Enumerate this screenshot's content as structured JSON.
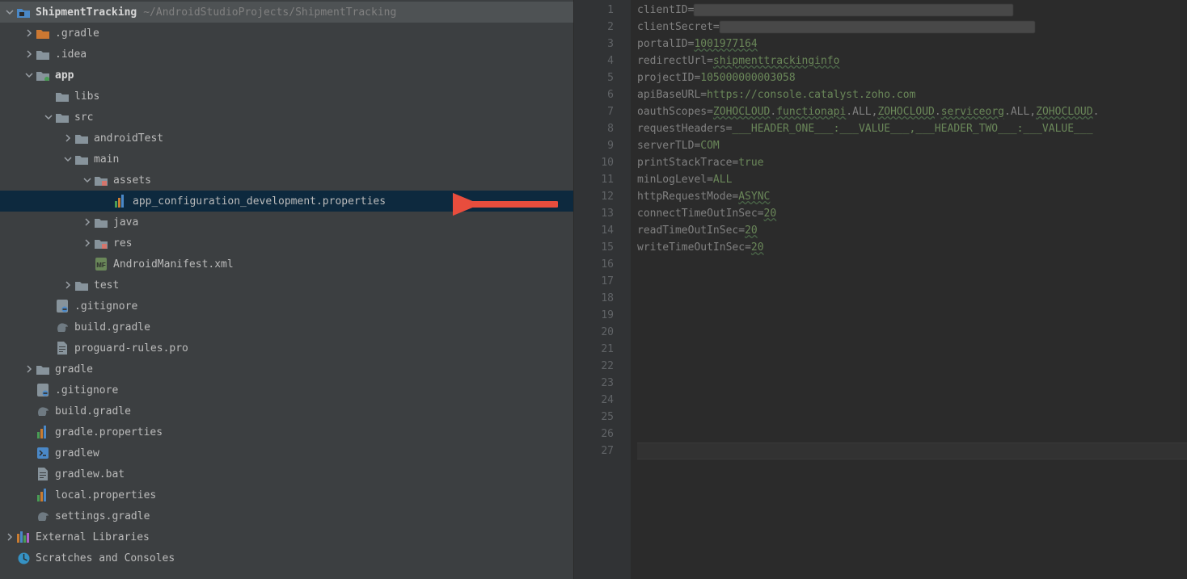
{
  "projectRoot": {
    "name": "ShipmentTracking",
    "path": "~/AndroidStudioProjects/ShipmentTracking"
  },
  "tree": [
    {
      "depth": 1,
      "arrow": "right",
      "icon": "folder-orange",
      "label": ".gradle"
    },
    {
      "depth": 1,
      "arrow": "right",
      "icon": "folder",
      "label": ".idea"
    },
    {
      "depth": 1,
      "arrow": "down",
      "icon": "module",
      "label": "app",
      "bold": true
    },
    {
      "depth": 2,
      "arrow": "none",
      "icon": "folder",
      "label": "libs"
    },
    {
      "depth": 2,
      "arrow": "down",
      "icon": "folder",
      "label": "src"
    },
    {
      "depth": 3,
      "arrow": "right",
      "icon": "folder",
      "label": "androidTest"
    },
    {
      "depth": 3,
      "arrow": "down",
      "icon": "folder",
      "label": "main"
    },
    {
      "depth": 4,
      "arrow": "down",
      "icon": "resource-folder",
      "label": "assets"
    },
    {
      "depth": 5,
      "arrow": "none",
      "icon": "properties",
      "label": "app_configuration_development.properties",
      "selected": true
    },
    {
      "depth": 4,
      "arrow": "right",
      "icon": "folder",
      "label": "java"
    },
    {
      "depth": 4,
      "arrow": "right",
      "icon": "resource-folder",
      "label": "res"
    },
    {
      "depth": 4,
      "arrow": "none",
      "icon": "manifest",
      "label": "AndroidManifest.xml"
    },
    {
      "depth": 3,
      "arrow": "right",
      "icon": "folder",
      "label": "test"
    },
    {
      "depth": 2,
      "arrow": "none",
      "icon": "gitignore",
      "label": ".gitignore"
    },
    {
      "depth": 2,
      "arrow": "none",
      "icon": "gradle-elephant",
      "label": "build.gradle"
    },
    {
      "depth": 2,
      "arrow": "none",
      "icon": "text-file",
      "label": "proguard-rules.pro"
    },
    {
      "depth": 1,
      "arrow": "right",
      "icon": "folder",
      "label": "gradle"
    },
    {
      "depth": 1,
      "arrow": "none",
      "icon": "gitignore",
      "label": ".gitignore"
    },
    {
      "depth": 1,
      "arrow": "none",
      "icon": "gradle-elephant",
      "label": "build.gradle"
    },
    {
      "depth": 1,
      "arrow": "none",
      "icon": "properties",
      "label": "gradle.properties"
    },
    {
      "depth": 1,
      "arrow": "none",
      "icon": "shell",
      "label": "gradlew"
    },
    {
      "depth": 1,
      "arrow": "none",
      "icon": "text-file",
      "label": "gradlew.bat"
    },
    {
      "depth": 1,
      "arrow": "none",
      "icon": "properties",
      "label": "local.properties"
    },
    {
      "depth": 1,
      "arrow": "none",
      "icon": "gradle-elephant",
      "label": "settings.gradle"
    },
    {
      "depth": 0,
      "arrow": "right",
      "icon": "libraries",
      "label": "External Libraries"
    },
    {
      "depth": 0,
      "arrow": "none",
      "icon": "scratches",
      "label": "Scratches and Consoles"
    }
  ],
  "editor": {
    "totalLines": 27,
    "caretLine": 27,
    "lines": [
      {
        "key": "clientID",
        "redactedWidth": 395
      },
      {
        "key": "clientSecret",
        "redactedWidth": 390
      },
      {
        "key": "portalID",
        "value": "1001977164",
        "underline": true
      },
      {
        "key": "redirectUrl",
        "value": "shipmenttrackinginfo",
        "underline": true
      },
      {
        "key": "projectID",
        "value": "105000000003058"
      },
      {
        "key": "apiBaseURL",
        "value": "https://console.catalyst.zoho.com"
      },
      {
        "key": "oauthScopes",
        "segments": [
          "ZOHOCLOUD",
          ".",
          "functionapi",
          ".ALL,",
          "ZOHOCLOUD",
          ".",
          "serviceorg",
          ".ALL,",
          "ZOHOCLOUD",
          "."
        ]
      },
      {
        "key": "requestHeaders",
        "value": "___HEADER_ONE___:___VALUE___,___HEADER_TWO___:___VALUE___"
      },
      {
        "key": "serverTLD",
        "value": "COM"
      },
      {
        "key": "printStackTrace",
        "value": "true"
      },
      {
        "key": "minLogLevel",
        "value": "ALL"
      },
      {
        "key": "httpRequestMode",
        "value": "ASYNC",
        "underline": true
      },
      {
        "key": "connectTimeOutInSec",
        "value": "20",
        "underline": true
      },
      {
        "key": "readTimeOutInSec",
        "value": "20",
        "underline": true
      },
      {
        "key": "writeTimeOutInSec",
        "value": "20",
        "underline": true
      }
    ]
  }
}
